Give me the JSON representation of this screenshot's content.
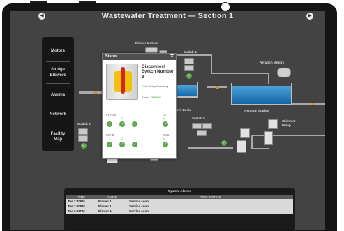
{
  "app": {
    "title": "Wastewater Treatment — Section 1"
  },
  "sidebar": {
    "items": [
      {
        "label": "Motors"
      },
      {
        "label": "Sludge Blowers"
      },
      {
        "label": "Alarms"
      },
      {
        "label": "Network"
      },
      {
        "label": "Facility Map"
      }
    ]
  },
  "diagram": {
    "labels": {
      "blower_motors": "Blower Motors",
      "switch4": "Switch 4",
      "aeration_motors": "Aeration Motors",
      "grit_basin": "Grit Basin",
      "aeration_station": "Aeration Station",
      "switch5": "Switch 5",
      "skimmer_pump": "Skimmer Pump",
      "switch3": "Switch 3",
      "inlet": "Inlet"
    }
  },
  "popup": {
    "title": "Status",
    "close": "X",
    "device_name": "Disconnect Switch Number 3",
    "device_sub": "Drain Pump Screening",
    "status_label": "Status:",
    "status_value": "ONLINE",
    "phase_label": "PHASE",
    "load_label": "LOAD",
    "dlt_label": "DLT",
    "gnd_label": "GND",
    "nums": [
      "1",
      "2",
      "3"
    ],
    "check": "✓"
  },
  "alarms": {
    "title": "System Alarms",
    "columns": [
      "TIME",
      "NAME",
      "DESCRIPTION"
    ],
    "rows": [
      [
        "Tue 3:40PM",
        "Blower 1",
        "Service soon"
      ],
      [
        "Tue 3:30PM",
        "Blower 1",
        "Service soon"
      ],
      [
        "Tue 3:15PM",
        "Blower 1",
        "Service soon"
      ]
    ]
  },
  "colors": {
    "background": "#434343",
    "status_online": "#4caf50",
    "water": "#1e7bc4",
    "switch_handle": "#d6261c",
    "switch_knob": "#f2c10e"
  },
  "icons": {
    "nav_left": "arrow-left-circle-icon",
    "nav_right": "arrow-right-circle-icon"
  }
}
